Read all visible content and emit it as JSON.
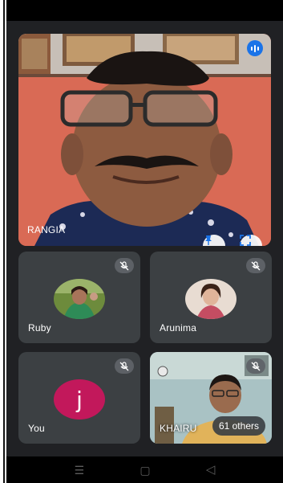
{
  "main_participant": {
    "name": "RANGIA",
    "speaking": true
  },
  "participants": [
    {
      "name": "Ruby",
      "muted": true
    },
    {
      "name": "Arunima",
      "muted": true
    },
    {
      "name": "You",
      "avatar_letter": "j",
      "muted": true
    },
    {
      "name": "KHAIRU",
      "muted": true
    }
  ],
  "others_count_label": "61 others",
  "icons": {
    "speaking": "speaking-indicator-icon",
    "pin": "pin-icon",
    "fullscreen": "fullscreen-icon",
    "mute": "mic-off-icon",
    "nav_recents": "recents-icon",
    "nav_home": "home-icon",
    "nav_back": "back-icon"
  },
  "colors": {
    "accent": "#1a73e8",
    "tile_bg": "#3c4043",
    "self_avatar": "#c2185b",
    "background": "#202124"
  }
}
